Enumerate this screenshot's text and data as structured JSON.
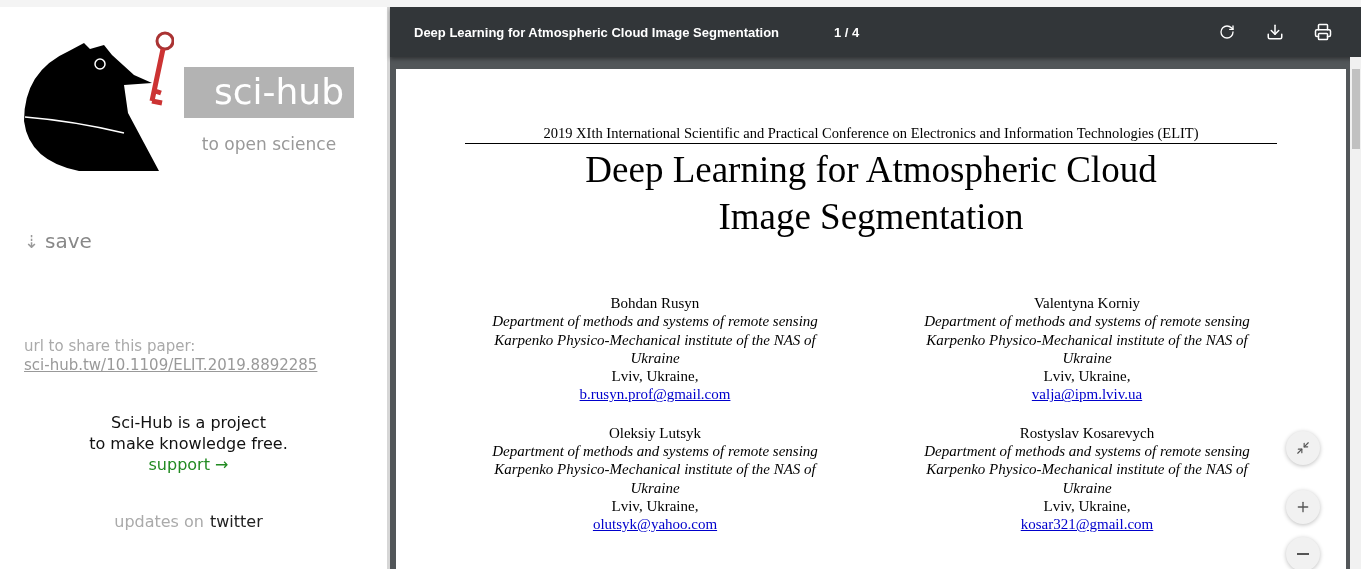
{
  "sidebar": {
    "logo_text": "sci-hub",
    "tagline": "to open science",
    "save": {
      "icon": "⇣",
      "label": "save"
    },
    "share_label": "url to share this paper:",
    "share_url": "sci-hub.tw/10.1109/ELIT.2019.8892285",
    "about_lines": [
      "Sci-Hub is a project",
      "to make knowledge free."
    ],
    "support_link": "support →",
    "updates": {
      "prefix": "updates on",
      "link": "twitter"
    }
  },
  "viewer": {
    "title": "Deep Learning for Atmospheric Cloud Image Segmentation",
    "page_counter": "1 / 4",
    "document": {
      "conference": "2019 XIth International Scientific and Practical Conference on Electronics and Information Technologies (ELIT)",
      "title_lines": [
        "Deep Learning for Atmospheric Cloud",
        "Image Segmentation"
      ],
      "authors": [
        {
          "name": "Bohdan Rusyn",
          "affiliation": [
            "Department of methods and systems of remote sensing",
            "Karpenko Physico-Mechanical institute of the NAS of",
            "Ukraine"
          ],
          "city": "Lviv, Ukraine,",
          "email": "b.rusyn.prof@gmail.com"
        },
        {
          "name": "Valentyna Korniy",
          "affiliation": [
            "Department of methods and systems of remote sensing",
            "Karpenko Physico-Mechanical institute of the NAS of",
            "Ukraine"
          ],
          "city": "Lviv, Ukraine,",
          "email": "valja@ipm.lviv.ua"
        },
        {
          "name": "Oleksiy Lutsyk",
          "affiliation": [
            "Department of methods and systems of remote sensing",
            "Karpenko Physico-Mechanical institute of the NAS of",
            "Ukraine"
          ],
          "city": "Lviv, Ukraine,",
          "email": "olutsyk@yahoo.com"
        },
        {
          "name": "Rostyslav Kosarevych",
          "affiliation": [
            "Department of methods and systems of remote sensing",
            "Karpenko Physico-Mechanical institute of the NAS of",
            "Ukraine"
          ],
          "city": "Lviv, Ukraine,",
          "email": "kosar321@gmail.com"
        }
      ]
    }
  }
}
